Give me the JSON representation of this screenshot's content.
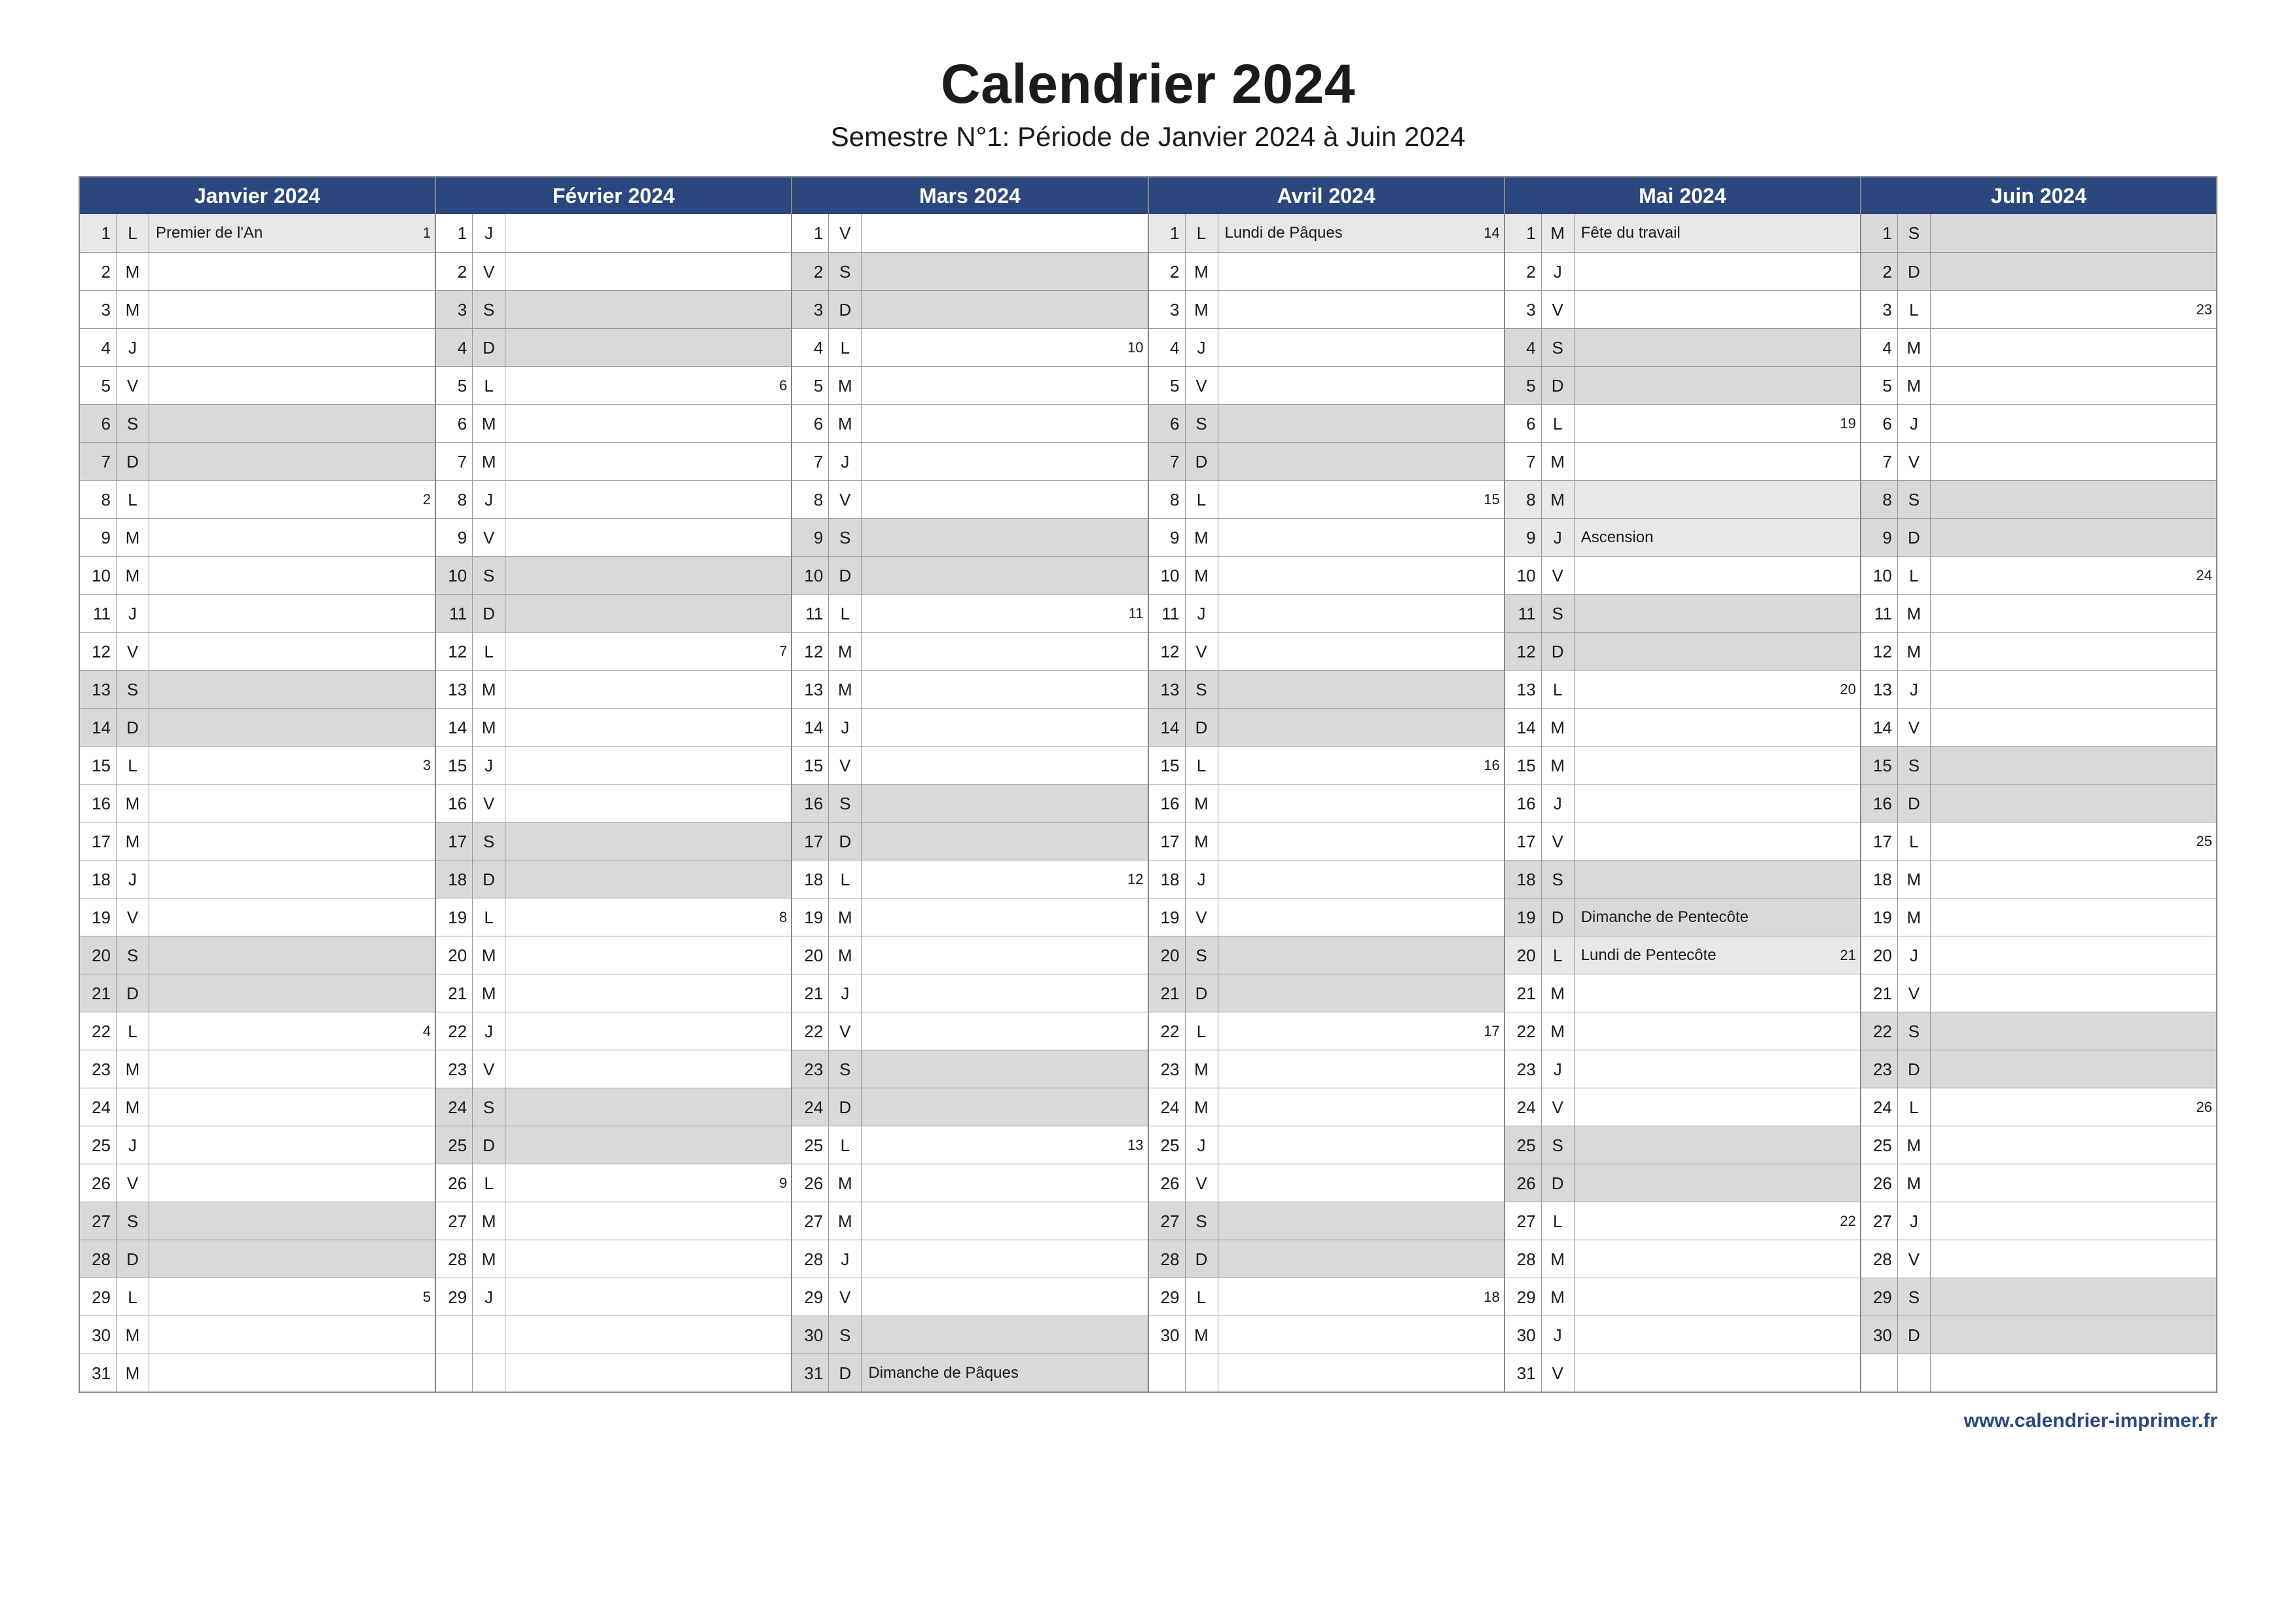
{
  "title": "Calendrier 2024",
  "subtitle": "Semestre N°1: Période de Janvier 2024 à Juin 2024",
  "footer": "www.calendrier-imprimer.fr",
  "months": [
    {
      "name": "Janvier 2024",
      "days": [
        {
          "n": 1,
          "d": "L",
          "note": "Premier de l'An",
          "week": 1,
          "holiday": true
        },
        {
          "n": 2,
          "d": "M"
        },
        {
          "n": 3,
          "d": "M"
        },
        {
          "n": 4,
          "d": "J"
        },
        {
          "n": 5,
          "d": "V"
        },
        {
          "n": 6,
          "d": "S",
          "shade": true
        },
        {
          "n": 7,
          "d": "D",
          "shade": true
        },
        {
          "n": 8,
          "d": "L",
          "week": 2
        },
        {
          "n": 9,
          "d": "M"
        },
        {
          "n": 10,
          "d": "M"
        },
        {
          "n": 11,
          "d": "J"
        },
        {
          "n": 12,
          "d": "V"
        },
        {
          "n": 13,
          "d": "S",
          "shade": true
        },
        {
          "n": 14,
          "d": "D",
          "shade": true
        },
        {
          "n": 15,
          "d": "L",
          "week": 3
        },
        {
          "n": 16,
          "d": "M"
        },
        {
          "n": 17,
          "d": "M"
        },
        {
          "n": 18,
          "d": "J"
        },
        {
          "n": 19,
          "d": "V"
        },
        {
          "n": 20,
          "d": "S",
          "shade": true
        },
        {
          "n": 21,
          "d": "D",
          "shade": true
        },
        {
          "n": 22,
          "d": "L",
          "week": 4
        },
        {
          "n": 23,
          "d": "M"
        },
        {
          "n": 24,
          "d": "M"
        },
        {
          "n": 25,
          "d": "J"
        },
        {
          "n": 26,
          "d": "V"
        },
        {
          "n": 27,
          "d": "S",
          "shade": true
        },
        {
          "n": 28,
          "d": "D",
          "shade": true
        },
        {
          "n": 29,
          "d": "L",
          "week": 5
        },
        {
          "n": 30,
          "d": "M"
        },
        {
          "n": 31,
          "d": "M"
        }
      ]
    },
    {
      "name": "Février 2024",
      "days": [
        {
          "n": 1,
          "d": "J"
        },
        {
          "n": 2,
          "d": "V"
        },
        {
          "n": 3,
          "d": "S",
          "shade": true
        },
        {
          "n": 4,
          "d": "D",
          "shade": true
        },
        {
          "n": 5,
          "d": "L",
          "week": 6
        },
        {
          "n": 6,
          "d": "M"
        },
        {
          "n": 7,
          "d": "M"
        },
        {
          "n": 8,
          "d": "J"
        },
        {
          "n": 9,
          "d": "V"
        },
        {
          "n": 10,
          "d": "S",
          "shade": true
        },
        {
          "n": 11,
          "d": "D",
          "shade": true
        },
        {
          "n": 12,
          "d": "L",
          "week": 7
        },
        {
          "n": 13,
          "d": "M"
        },
        {
          "n": 14,
          "d": "M"
        },
        {
          "n": 15,
          "d": "J"
        },
        {
          "n": 16,
          "d": "V"
        },
        {
          "n": 17,
          "d": "S",
          "shade": true
        },
        {
          "n": 18,
          "d": "D",
          "shade": true
        },
        {
          "n": 19,
          "d": "L",
          "week": 8
        },
        {
          "n": 20,
          "d": "M"
        },
        {
          "n": 21,
          "d": "M"
        },
        {
          "n": 22,
          "d": "J"
        },
        {
          "n": 23,
          "d": "V"
        },
        {
          "n": 24,
          "d": "S",
          "shade": true
        },
        {
          "n": 25,
          "d": "D",
          "shade": true
        },
        {
          "n": 26,
          "d": "L",
          "week": 9
        },
        {
          "n": 27,
          "d": "M"
        },
        {
          "n": 28,
          "d": "M"
        },
        {
          "n": 29,
          "d": "J"
        }
      ]
    },
    {
      "name": "Mars 2024",
      "days": [
        {
          "n": 1,
          "d": "V"
        },
        {
          "n": 2,
          "d": "S",
          "shade": true
        },
        {
          "n": 3,
          "d": "D",
          "shade": true
        },
        {
          "n": 4,
          "d": "L",
          "week": 10
        },
        {
          "n": 5,
          "d": "M"
        },
        {
          "n": 6,
          "d": "M"
        },
        {
          "n": 7,
          "d": "J"
        },
        {
          "n": 8,
          "d": "V"
        },
        {
          "n": 9,
          "d": "S",
          "shade": true
        },
        {
          "n": 10,
          "d": "D",
          "shade": true
        },
        {
          "n": 11,
          "d": "L",
          "week": 11
        },
        {
          "n": 12,
          "d": "M"
        },
        {
          "n": 13,
          "d": "M"
        },
        {
          "n": 14,
          "d": "J"
        },
        {
          "n": 15,
          "d": "V"
        },
        {
          "n": 16,
          "d": "S",
          "shade": true
        },
        {
          "n": 17,
          "d": "D",
          "shade": true
        },
        {
          "n": 18,
          "d": "L",
          "week": 12
        },
        {
          "n": 19,
          "d": "M"
        },
        {
          "n": 20,
          "d": "M"
        },
        {
          "n": 21,
          "d": "J"
        },
        {
          "n": 22,
          "d": "V"
        },
        {
          "n": 23,
          "d": "S",
          "shade": true
        },
        {
          "n": 24,
          "d": "D",
          "shade": true
        },
        {
          "n": 25,
          "d": "L",
          "week": 13
        },
        {
          "n": 26,
          "d": "M"
        },
        {
          "n": 27,
          "d": "M"
        },
        {
          "n": 28,
          "d": "J"
        },
        {
          "n": 29,
          "d": "V"
        },
        {
          "n": 30,
          "d": "S",
          "shade": true
        },
        {
          "n": 31,
          "d": "D",
          "note": "Dimanche de Pâques",
          "shade": true
        }
      ]
    },
    {
      "name": "Avril 2024",
      "days": [
        {
          "n": 1,
          "d": "L",
          "note": "Lundi de Pâques",
          "week": 14,
          "holiday": true
        },
        {
          "n": 2,
          "d": "M"
        },
        {
          "n": 3,
          "d": "M"
        },
        {
          "n": 4,
          "d": "J"
        },
        {
          "n": 5,
          "d": "V"
        },
        {
          "n": 6,
          "d": "S",
          "shade": true
        },
        {
          "n": 7,
          "d": "D",
          "shade": true
        },
        {
          "n": 8,
          "d": "L",
          "week": 15
        },
        {
          "n": 9,
          "d": "M"
        },
        {
          "n": 10,
          "d": "M"
        },
        {
          "n": 11,
          "d": "J"
        },
        {
          "n": 12,
          "d": "V"
        },
        {
          "n": 13,
          "d": "S",
          "shade": true
        },
        {
          "n": 14,
          "d": "D",
          "shade": true
        },
        {
          "n": 15,
          "d": "L",
          "week": 16
        },
        {
          "n": 16,
          "d": "M"
        },
        {
          "n": 17,
          "d": "M"
        },
        {
          "n": 18,
          "d": "J"
        },
        {
          "n": 19,
          "d": "V"
        },
        {
          "n": 20,
          "d": "S",
          "shade": true
        },
        {
          "n": 21,
          "d": "D",
          "shade": true
        },
        {
          "n": 22,
          "d": "L",
          "week": 17
        },
        {
          "n": 23,
          "d": "M"
        },
        {
          "n": 24,
          "d": "M"
        },
        {
          "n": 25,
          "d": "J"
        },
        {
          "n": 26,
          "d": "V"
        },
        {
          "n": 27,
          "d": "S",
          "shade": true
        },
        {
          "n": 28,
          "d": "D",
          "shade": true
        },
        {
          "n": 29,
          "d": "L",
          "week": 18
        },
        {
          "n": 30,
          "d": "M"
        }
      ]
    },
    {
      "name": "Mai 2024",
      "days": [
        {
          "n": 1,
          "d": "M",
          "note": "Fête du travail",
          "holiday": true
        },
        {
          "n": 2,
          "d": "J"
        },
        {
          "n": 3,
          "d": "V"
        },
        {
          "n": 4,
          "d": "S",
          "shade": true
        },
        {
          "n": 5,
          "d": "D",
          "shade": true
        },
        {
          "n": 6,
          "d": "L",
          "week": 19
        },
        {
          "n": 7,
          "d": "M"
        },
        {
          "n": 8,
          "d": "M",
          "holiday": true
        },
        {
          "n": 9,
          "d": "J",
          "note": "Ascension",
          "holiday": true
        },
        {
          "n": 10,
          "d": "V"
        },
        {
          "n": 11,
          "d": "S",
          "shade": true
        },
        {
          "n": 12,
          "d": "D",
          "shade": true
        },
        {
          "n": 13,
          "d": "L",
          "week": 20
        },
        {
          "n": 14,
          "d": "M"
        },
        {
          "n": 15,
          "d": "M"
        },
        {
          "n": 16,
          "d": "J"
        },
        {
          "n": 17,
          "d": "V"
        },
        {
          "n": 18,
          "d": "S",
          "shade": true
        },
        {
          "n": 19,
          "d": "D",
          "note": "Dimanche de Pentecôte",
          "shade": true
        },
        {
          "n": 20,
          "d": "L",
          "note": "Lundi de Pentecôte",
          "week": 21,
          "holiday": true
        },
        {
          "n": 21,
          "d": "M"
        },
        {
          "n": 22,
          "d": "M"
        },
        {
          "n": 23,
          "d": "J"
        },
        {
          "n": 24,
          "d": "V"
        },
        {
          "n": 25,
          "d": "S",
          "shade": true
        },
        {
          "n": 26,
          "d": "D",
          "shade": true
        },
        {
          "n": 27,
          "d": "L",
          "week": 22
        },
        {
          "n": 28,
          "d": "M"
        },
        {
          "n": 29,
          "d": "M"
        },
        {
          "n": 30,
          "d": "J"
        },
        {
          "n": 31,
          "d": "V"
        }
      ]
    },
    {
      "name": "Juin 2024",
      "days": [
        {
          "n": 1,
          "d": "S",
          "shade": true
        },
        {
          "n": 2,
          "d": "D",
          "shade": true
        },
        {
          "n": 3,
          "d": "L",
          "week": 23
        },
        {
          "n": 4,
          "d": "M"
        },
        {
          "n": 5,
          "d": "M"
        },
        {
          "n": 6,
          "d": "J"
        },
        {
          "n": 7,
          "d": "V"
        },
        {
          "n": 8,
          "d": "S",
          "shade": true
        },
        {
          "n": 9,
          "d": "D",
          "shade": true
        },
        {
          "n": 10,
          "d": "L",
          "week": 24
        },
        {
          "n": 11,
          "d": "M"
        },
        {
          "n": 12,
          "d": "M"
        },
        {
          "n": 13,
          "d": "J"
        },
        {
          "n": 14,
          "d": "V"
        },
        {
          "n": 15,
          "d": "S",
          "shade": true
        },
        {
          "n": 16,
          "d": "D",
          "shade": true
        },
        {
          "n": 17,
          "d": "L",
          "week": 25
        },
        {
          "n": 18,
          "d": "M"
        },
        {
          "n": 19,
          "d": "M"
        },
        {
          "n": 20,
          "d": "J"
        },
        {
          "n": 21,
          "d": "V"
        },
        {
          "n": 22,
          "d": "S",
          "shade": true
        },
        {
          "n": 23,
          "d": "D",
          "shade": true
        },
        {
          "n": 24,
          "d": "L",
          "week": 26
        },
        {
          "n": 25,
          "d": "M"
        },
        {
          "n": 26,
          "d": "M"
        },
        {
          "n": 27,
          "d": "J"
        },
        {
          "n": 28,
          "d": "V"
        },
        {
          "n": 29,
          "d": "S",
          "shade": true
        },
        {
          "n": 30,
          "d": "D",
          "shade": true
        }
      ]
    }
  ]
}
